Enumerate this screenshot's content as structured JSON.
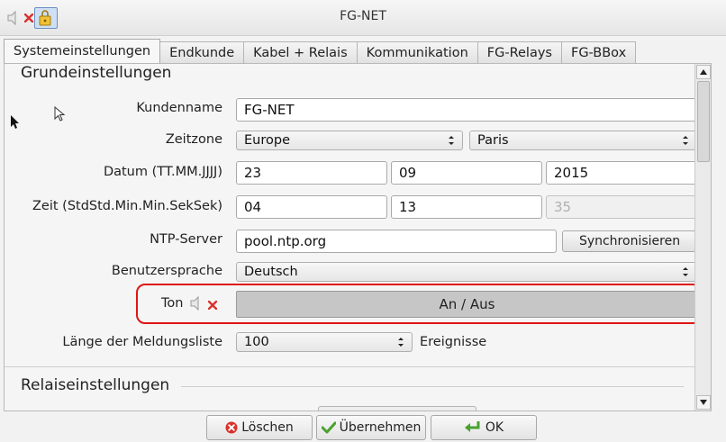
{
  "window": {
    "title": "FG-NET"
  },
  "tabs": [
    {
      "label": "Systemeinstellungen"
    },
    {
      "label": "Endkunde"
    },
    {
      "label": "Kabel + Relais"
    },
    {
      "label": "Kommunikation"
    },
    {
      "label": "FG-Relays"
    },
    {
      "label": "FG-BBox"
    }
  ],
  "basic": {
    "title": "Grundeinstellungen",
    "customer_name_label": "Kundenname",
    "customer_name_value": "FG-NET",
    "timezone_label": "Zeitzone",
    "timezone_region": "Europe",
    "timezone_city": "Paris",
    "date_label": "Datum (TT.MM.JJJJ)",
    "date_day": "23",
    "date_month": "09",
    "date_year": "2015",
    "time_label": "Zeit (StdStd.Min.Min.SekSek)",
    "time_hour": "04",
    "time_minute": "13",
    "time_second": "35",
    "ntp_label": "NTP-Server",
    "ntp_value": "pool.ntp.org",
    "sync_button": "Synchronisieren",
    "language_label": "Benutzersprache",
    "language_value": "Deutsch",
    "sound_label": "Ton",
    "sound_toggle": "An / Aus",
    "message_list_label": "Länge der Meldungsliste",
    "message_list_value": "100",
    "message_list_unit": "Ereignisse"
  },
  "relay": {
    "title": "Relaiseinstellungen"
  },
  "buttons": {
    "delete": "Löschen",
    "apply": "Übernehmen",
    "ok": "OK"
  },
  "colors": {
    "highlight": "#e01515",
    "accent_blue": "#3b6fc1",
    "delete_red": "#d9312b",
    "ok_green": "#4aa12e"
  }
}
